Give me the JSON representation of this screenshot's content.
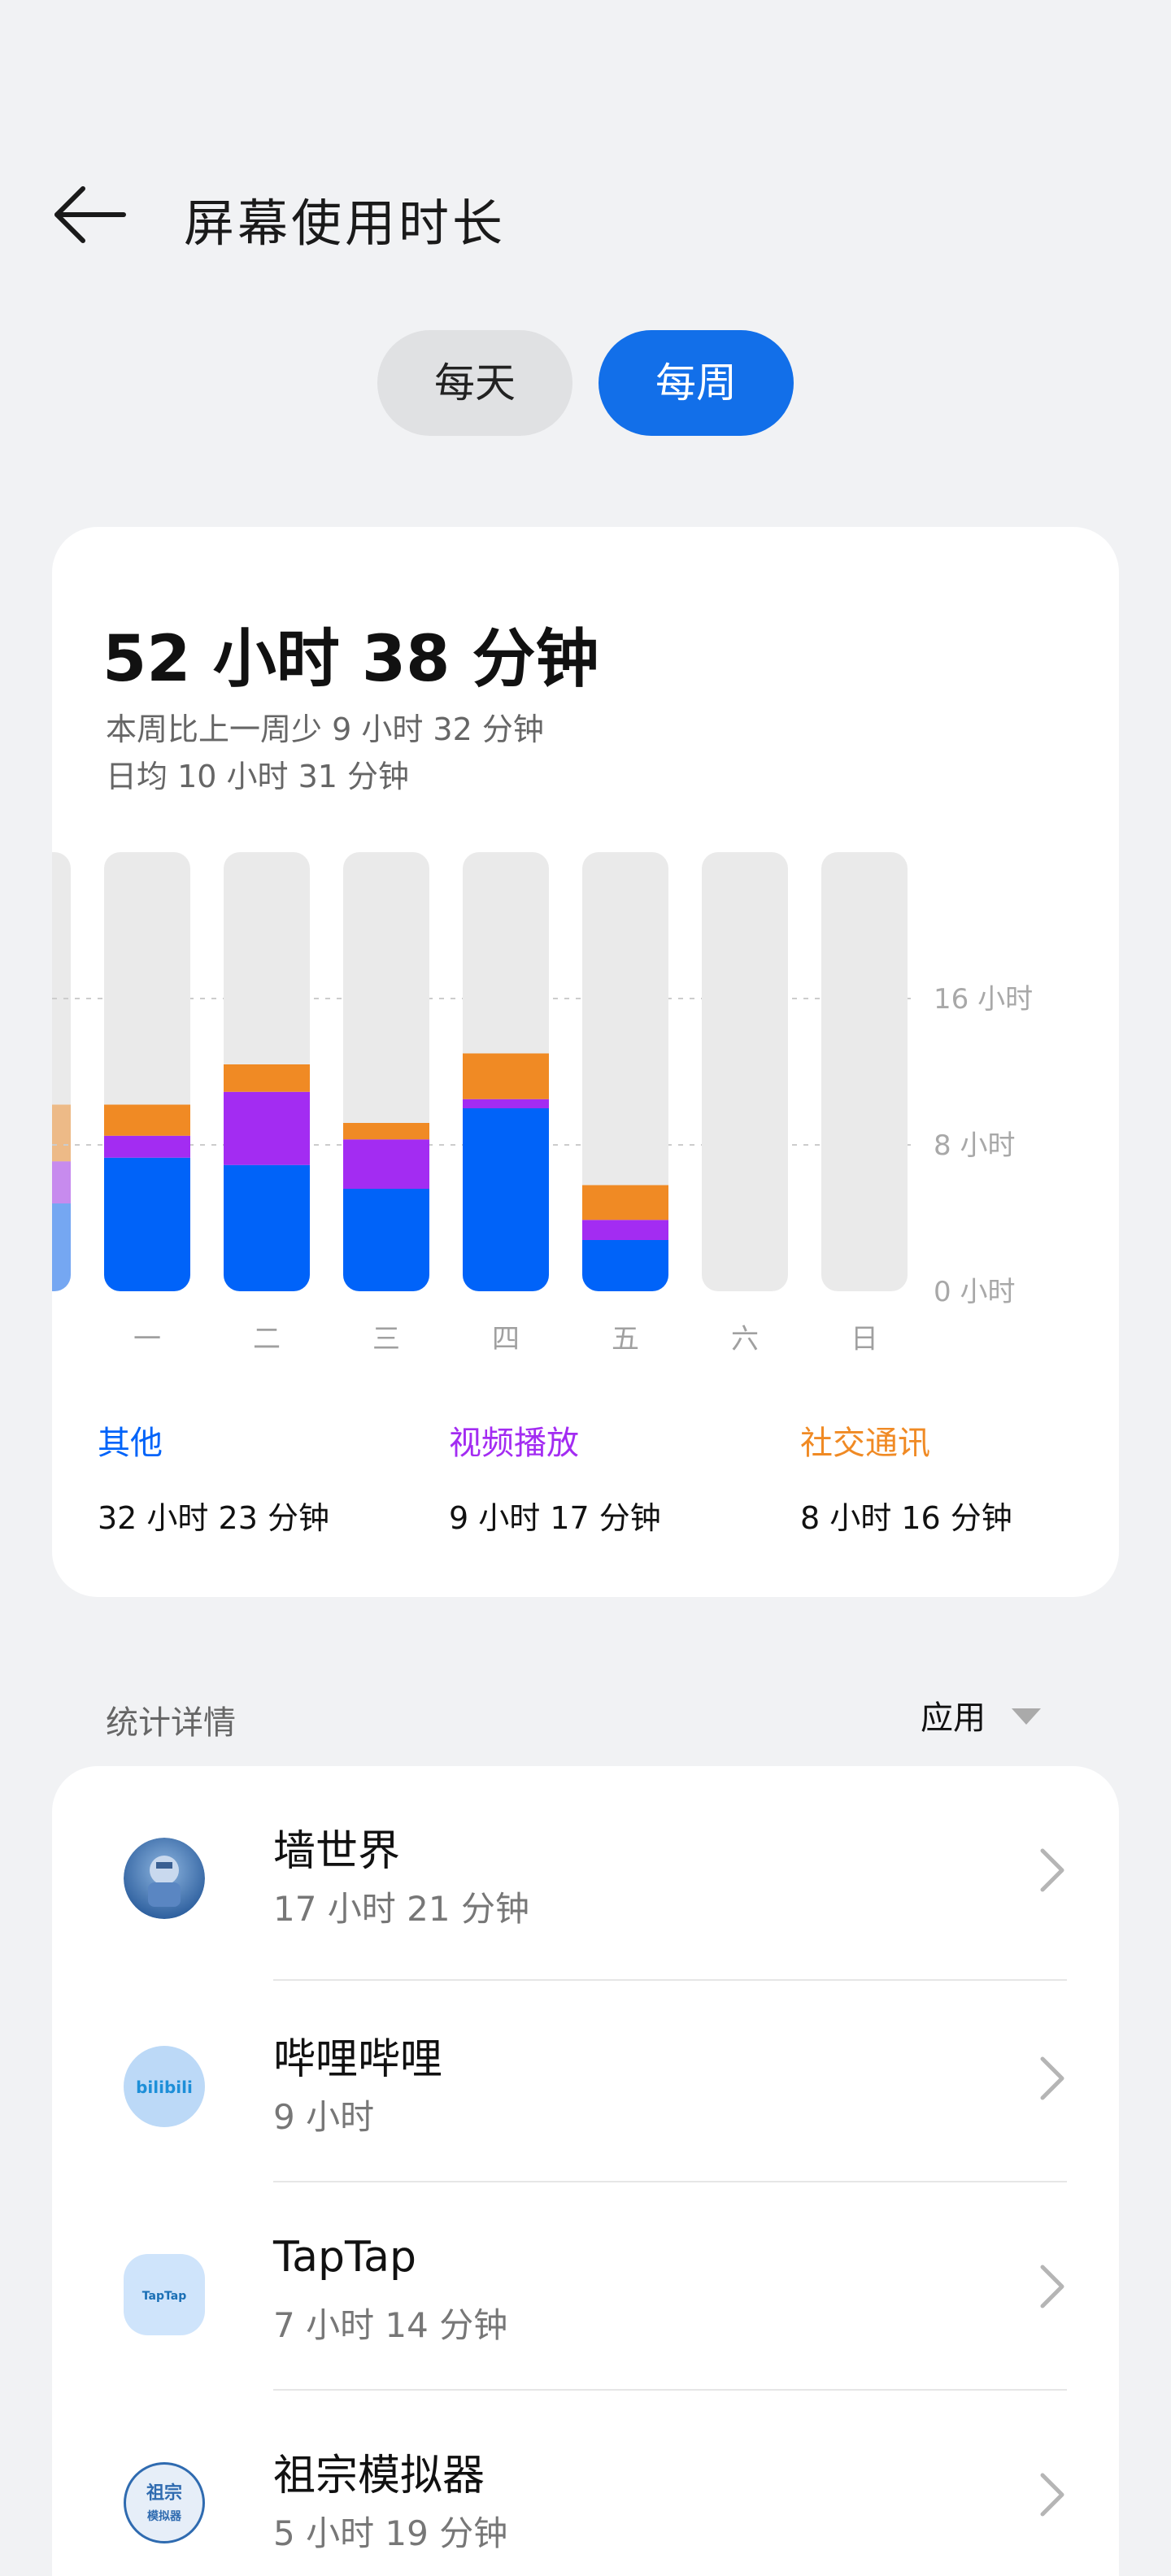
{
  "header": {
    "title": "屏幕使用时长"
  },
  "toggle": {
    "day_label": "每天",
    "week_label": "每周",
    "selected": "week"
  },
  "summary": {
    "total": "52 小时 38 分钟",
    "compare": "本周比上一周少 9 小时 32 分钟",
    "average": "日均 10 小时 31 分钟"
  },
  "colors": {
    "other": "#0063f9",
    "video": "#a32cf2",
    "social": "#f08a24",
    "track": "#eaeaea",
    "accent": "#126fe9"
  },
  "chart_data": {
    "type": "bar",
    "stacked": true,
    "categories": [
      "一",
      "二",
      "三",
      "四",
      "五",
      "六",
      "日"
    ],
    "y_ticks": [
      "0 小时",
      "8 小时",
      "16 小时"
    ],
    "ylim": [
      0,
      24
    ],
    "grid": "dashed at 8 and 16",
    "series": [
      {
        "name": "其他",
        "color": "#0063f9",
        "values": [
          7.3,
          6.9,
          5.6,
          10.0,
          2.8,
          0,
          0
        ]
      },
      {
        "name": "视频播放",
        "color": "#a32cf2",
        "values": [
          1.2,
          4.0,
          2.7,
          0.5,
          1.1,
          0,
          0
        ]
      },
      {
        "name": "社交通讯",
        "color": "#f08a24",
        "values": [
          1.7,
          1.5,
          0.9,
          2.5,
          1.9,
          0,
          0
        ]
      }
    ],
    "partial_prev_week_bar": {
      "other": 4.8,
      "video": 2.3,
      "social": 3.1
    }
  },
  "legend": [
    {
      "label": "其他",
      "value": "32 小时 23 分钟",
      "color": "#0063f9"
    },
    {
      "label": "视频播放",
      "value": "9 小时 17 分钟",
      "color": "#a32cf2"
    },
    {
      "label": "社交通讯",
      "value": "8 小时 16 分钟",
      "color": "#f08a24"
    }
  ],
  "stats": {
    "title": "统计详情",
    "sort_label": "应用"
  },
  "apps": [
    {
      "name": "墙世界",
      "time": "17 小时 21 分钟",
      "icon": "wall-world-icon"
    },
    {
      "name": "哔哩哔哩",
      "time": "9 小时",
      "icon": "bilibili-icon",
      "icon_text": "bilibili"
    },
    {
      "name": "TapTap",
      "time": "7 小时 14 分钟",
      "icon": "taptap-icon",
      "icon_text": "TapTap"
    },
    {
      "name": "祖宗模拟器",
      "time": "5 小时 19 分钟",
      "icon": "ancestor-simulator-icon",
      "icon_text": "祖宗模拟器"
    }
  ]
}
